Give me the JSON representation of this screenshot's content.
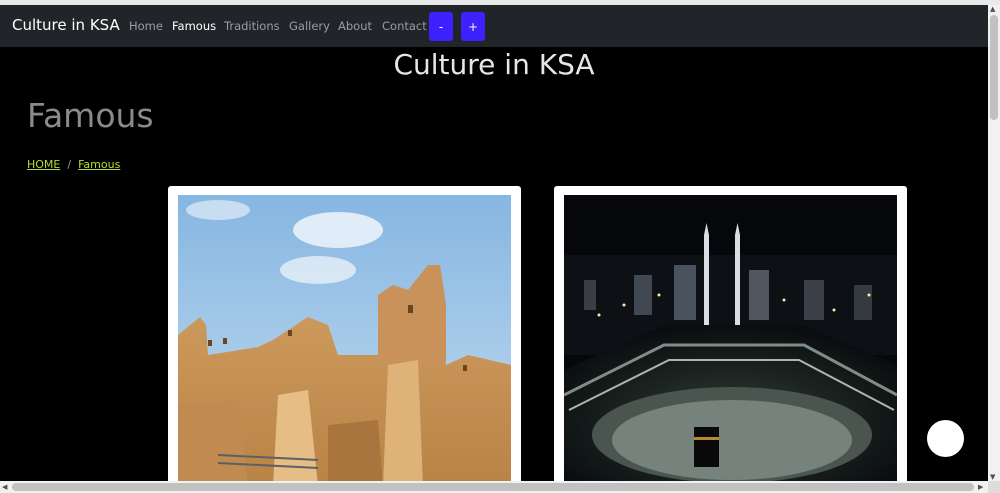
{
  "navbar": {
    "brand": "Culture in KSA",
    "links": [
      "Home",
      "Famous",
      "Traditions",
      "Gallery",
      "About",
      "Contact"
    ],
    "active": "Famous",
    "decrease_label": "-",
    "increase_label": "+"
  },
  "header": {
    "site_title": "Culture in KSA"
  },
  "page": {
    "title": "Famous"
  },
  "breadcrumb": {
    "home": "HOME",
    "separator": "/",
    "current": "Famous"
  },
  "cards": [
    {
      "image": "diriyah-mud-ruins"
    },
    {
      "image": "masjid-al-haram-night"
    }
  ],
  "colors": {
    "navbar_bg": "#212529",
    "button_bg": "#3d21ff",
    "link_accent": "#b5dd33",
    "page_bg": "#000000"
  }
}
